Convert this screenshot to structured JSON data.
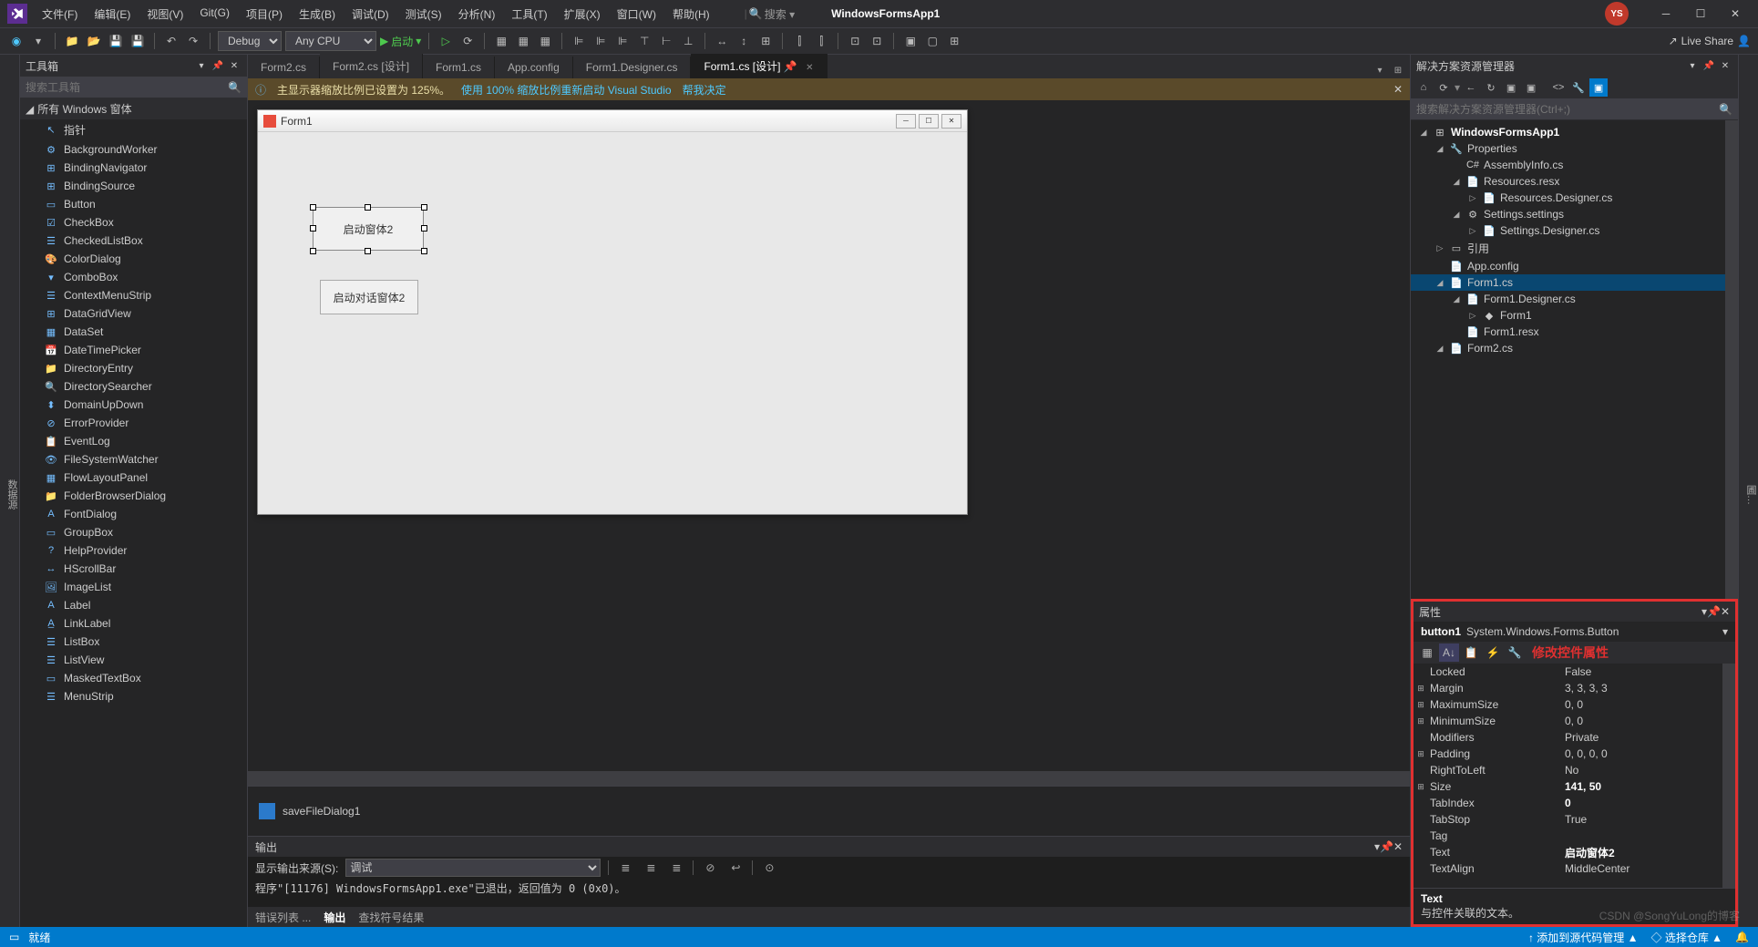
{
  "title": {
    "app_name": "WindowsFormsApp1",
    "user_initials": "YS"
  },
  "menubar": [
    "文件(F)",
    "编辑(E)",
    "视图(V)",
    "Git(G)",
    "项目(P)",
    "生成(B)",
    "调试(D)",
    "测试(S)",
    "分析(N)",
    "工具(T)",
    "扩展(X)",
    "窗口(W)",
    "帮助(H)"
  ],
  "search_label": "搜索 ▾",
  "toolbar": {
    "config": "Debug",
    "platform": "Any CPU",
    "run_label": "启动",
    "live_share": "Live Share"
  },
  "left_strip": "数据源",
  "toolbox": {
    "title": "工具箱",
    "search_placeholder": "搜索工具箱",
    "category": "所有 Windows 窗体",
    "items": [
      "指针",
      "BackgroundWorker",
      "BindingNavigator",
      "BindingSource",
      "Button",
      "CheckBox",
      "CheckedListBox",
      "ColorDialog",
      "ComboBox",
      "ContextMenuStrip",
      "DataGridView",
      "DataSet",
      "DateTimePicker",
      "DirectoryEntry",
      "DirectorySearcher",
      "DomainUpDown",
      "ErrorProvider",
      "EventLog",
      "FileSystemWatcher",
      "FlowLayoutPanel",
      "FolderBrowserDialog",
      "FontDialog",
      "GroupBox",
      "HelpProvider",
      "HScrollBar",
      "ImageList",
      "Label",
      "LinkLabel",
      "ListBox",
      "ListView",
      "MaskedTextBox",
      "MenuStrip"
    ]
  },
  "tabs": {
    "items": [
      "Form2.cs",
      "Form2.cs [设计]",
      "Form1.cs",
      "App.config",
      "Form1.Designer.cs",
      "Form1.cs [设计]"
    ],
    "active_index": 5
  },
  "infobar": {
    "icon": "ⓘ",
    "msg": "主显示器缩放比例已设置为 125%。",
    "link1": "使用 100% 缩放比例重新启动 Visual Studio",
    "link2": "帮我决定"
  },
  "designer": {
    "form_title": "Form1",
    "button1_text": "启动窗体2",
    "button2_text": "启动对话窗体2",
    "tray_item": "saveFileDialog1"
  },
  "output": {
    "title": "输出",
    "src_label": "显示输出来源(S):",
    "src_value": "调试",
    "body": "程序\"[11176] WindowsFormsApp1.exe\"已退出，返回值为 0 (0x0)。",
    "footer_tabs": [
      "错误列表 ...",
      "输出",
      "查找符号结果"
    ],
    "footer_active": 1
  },
  "solution": {
    "title": "解决方案资源管理器",
    "search_placeholder": "搜索解决方案资源管理器(Ctrl+;)",
    "nodes": [
      {
        "depth": 0,
        "exp": "◢",
        "icon": "⊞",
        "label": "WindowsFormsApp1",
        "bold": true
      },
      {
        "depth": 1,
        "exp": "◢",
        "icon": "🔧",
        "label": "Properties"
      },
      {
        "depth": 2,
        "exp": "",
        "icon": "C#",
        "label": "AssemblyInfo.cs"
      },
      {
        "depth": 2,
        "exp": "◢",
        "icon": "📄",
        "label": "Resources.resx"
      },
      {
        "depth": 3,
        "exp": "▷",
        "icon": "📄",
        "label": "Resources.Designer.cs"
      },
      {
        "depth": 2,
        "exp": "◢",
        "icon": "⚙",
        "label": "Settings.settings"
      },
      {
        "depth": 3,
        "exp": "▷",
        "icon": "📄",
        "label": "Settings.Designer.cs"
      },
      {
        "depth": 1,
        "exp": "▷",
        "icon": "▭",
        "label": "引用"
      },
      {
        "depth": 1,
        "exp": "",
        "icon": "📄",
        "label": "App.config"
      },
      {
        "depth": 1,
        "exp": "◢",
        "icon": "📄",
        "label": "Form1.cs",
        "sel": true
      },
      {
        "depth": 2,
        "exp": "◢",
        "icon": "📄",
        "label": "Form1.Designer.cs"
      },
      {
        "depth": 3,
        "exp": "▷",
        "icon": "◆",
        "label": "Form1"
      },
      {
        "depth": 2,
        "exp": "",
        "icon": "📄",
        "label": "Form1.resx"
      },
      {
        "depth": 1,
        "exp": "◢",
        "icon": "📄",
        "label": "Form2.cs"
      }
    ]
  },
  "properties": {
    "title": "属性",
    "obj_name": "button1",
    "obj_type": "System.Windows.Forms.Button",
    "annotation": "修改控件属性",
    "rows": [
      {
        "exp": "",
        "name": "Locked",
        "val": "False"
      },
      {
        "exp": "⊞",
        "name": "Margin",
        "val": "3, 3, 3, 3"
      },
      {
        "exp": "⊞",
        "name": "MaximumSize",
        "val": "0, 0"
      },
      {
        "exp": "⊞",
        "name": "MinimumSize",
        "val": "0, 0"
      },
      {
        "exp": "",
        "name": "Modifiers",
        "val": "Private"
      },
      {
        "exp": "⊞",
        "name": "Padding",
        "val": "0, 0, 0, 0"
      },
      {
        "exp": "",
        "name": "RightToLeft",
        "val": "No"
      },
      {
        "exp": "⊞",
        "name": "Size",
        "val": "141, 50",
        "hl": true
      },
      {
        "exp": "",
        "name": "TabIndex",
        "val": "0",
        "hl": true
      },
      {
        "exp": "",
        "name": "TabStop",
        "val": "True"
      },
      {
        "exp": "",
        "name": "Tag",
        "val": ""
      },
      {
        "exp": "",
        "name": "Text",
        "val": "启动窗体2",
        "hl": true
      },
      {
        "exp": "",
        "name": "TextAlign",
        "val": "MiddleCenter"
      }
    ],
    "desc_title": "Text",
    "desc_body": "与控件关联的文本。"
  },
  "right_strip": "圃…",
  "status": {
    "left": "就绪",
    "r1": "↑ 添加到源代码管理 ▲",
    "r2": "◇ 选择仓库 ▲",
    "r3": "🔔"
  },
  "watermark": "CSDN @SongYuLong的博客"
}
